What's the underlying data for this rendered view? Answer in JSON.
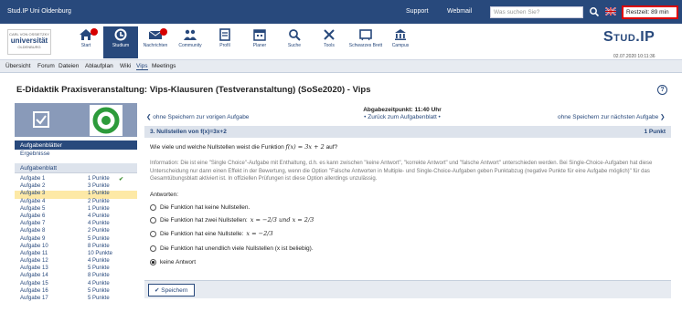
{
  "topbar": {
    "brand": "Stud.IP Uni Oldenburg",
    "support": "Support",
    "webmail": "Webmail",
    "search_placeholder": "Was suchen Sie?",
    "restzeit": "Restzeit: 89 min"
  },
  "navbar": {
    "items": [
      {
        "label": "Start",
        "icon": "home-icon"
      },
      {
        "label": "Studium",
        "icon": "seminar-icon"
      },
      {
        "label": "Nachrichten",
        "icon": "mail-icon"
      },
      {
        "label": "Community",
        "icon": "community-icon"
      },
      {
        "label": "Profil",
        "icon": "profile-icon"
      },
      {
        "label": "Planer",
        "icon": "calendar-icon"
      },
      {
        "label": "Suche",
        "icon": "search-icon"
      },
      {
        "label": "Tools",
        "icon": "tools-icon"
      },
      {
        "label": "Schwarzes Brett",
        "icon": "board-icon"
      },
      {
        "label": "Campus",
        "icon": "campus-icon"
      }
    ],
    "logo_uni": "universität",
    "logo_uni_top": "CARL VON OSSIETZKY",
    "logo_uni_bottom": "OLDENBURG",
    "studip_logo": "Stud.IP",
    "date": "02.07.2020 10:11:36"
  },
  "subnav": [
    "Übersicht",
    "Forum",
    "Dateien",
    "Ablaufplan",
    "Wiki",
    "Vips",
    "Meetings"
  ],
  "page_title": "E-Didaktik Praxisveranstaltung: Vips-Klausuren (Testveranstaltung) (SoSe2020) - Vips",
  "sidebar": {
    "section_active": "Aufgabenblätter",
    "section_link": "Ergebnisse",
    "list_title": "Aufgabenblatt",
    "rows": [
      {
        "name": "Aufgabe 1",
        "points": "1 Punkte",
        "done": true
      },
      {
        "name": "Aufgabe 2",
        "points": "3 Punkte"
      },
      {
        "name": "Aufgabe 3",
        "points": "1 Punkte",
        "selected": true
      },
      {
        "name": "Aufgabe 4",
        "points": "2 Punkte"
      },
      {
        "name": "Aufgabe 5",
        "points": "1 Punkte"
      },
      {
        "name": "Aufgabe 6",
        "points": "4 Punkte"
      },
      {
        "name": "Aufgabe 7",
        "points": "4 Punkte"
      },
      {
        "name": "Aufgabe 8",
        "points": "2 Punkte"
      },
      {
        "name": "Aufgabe 9",
        "points": "5 Punkte"
      },
      {
        "name": "Aufgabe 10",
        "points": "8 Punkte"
      },
      {
        "name": "Aufgabe 11",
        "points": "10 Punkte"
      },
      {
        "name": "Aufgabe 12",
        "points": "4 Punkte"
      },
      {
        "name": "Aufgabe 13",
        "points": "5 Punkte"
      },
      {
        "name": "Aufgabe 14",
        "points": "8 Punkte"
      },
      {
        "name": "Aufgabe 15",
        "points": "4 Punkte"
      },
      {
        "name": "Aufgabe 16",
        "points": "5 Punkte"
      },
      {
        "name": "Aufgabe 17",
        "points": "5 Punkte"
      }
    ]
  },
  "taskbar": {
    "prev": "ohne Speichern zur vorigen Aufgabe",
    "deadline": "Abgabezeitpunkt: 11:40 Uhr",
    "back": "• Zurück zum Aufgabenblatt •",
    "next": "ohne Speichern zur nächsten Aufgabe"
  },
  "question": {
    "header": "3. Nullstellen von f(x)=3x+2",
    "points": "1 Punkt",
    "text_prefix": "Wie viele und welche Nullstellen weist die Funktion",
    "text_formula": "f(x) = 3x + 2",
    "text_suffix": "auf?",
    "info": "Information: Die ist eine \"Single Choice\"-Aufgabe mit Enthaltung, d.h. es kann zwischen \"keine Antwort\", \"korrekte Antwort\" und \"falsche Antwort\" unterschieden werden. Bei Single-Choice-Aufgaben hat diese Unterscheidung nur dann einen Effekt in der Bewertung, wenn die Option \"Falsche Antworten in Multiple- und Single-Choice-Aufgaben geben Punktabzug (negative Punkte für eine Aufgabe möglich)\" für das Gesamtübungsblatt aktiviert ist. In offiziellen Prüfungen ist diese Option allerdings unzulässig.",
    "answers_label": "Antworten:",
    "options": [
      {
        "text": "Die Funktion hat keine Nullstellen.",
        "formula": ""
      },
      {
        "text": "Die Funktion hat zwei Nullstellen:",
        "formula": "x = −2/3 und x = 2/3"
      },
      {
        "text": "Die Funktion hat eine Nullstelle:",
        "formula": "x = −2/3"
      },
      {
        "text": "Die Funktion hat unendlich viele Nullstellen (x ist beliebig).",
        "formula": ""
      },
      {
        "text": "keine Antwort",
        "formula": "",
        "checked": true
      }
    ],
    "save": "Speichern"
  }
}
